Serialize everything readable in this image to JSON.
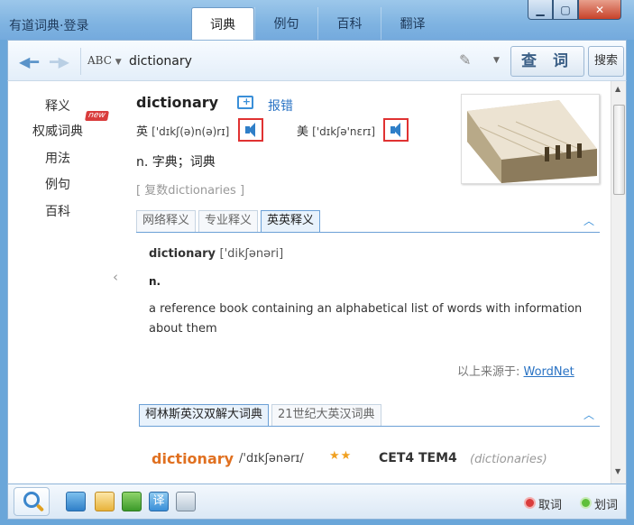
{
  "window": {
    "app_name": "有道词典",
    "login": "·登录",
    "tabs": [
      {
        "label": "词典",
        "active": true
      },
      {
        "label": "例句",
        "active": false
      },
      {
        "label": "百科",
        "active": false
      },
      {
        "label": "翻译",
        "active": false
      }
    ]
  },
  "search": {
    "abc_label": "ABC",
    "value": "dictionary",
    "lookup_button": "查 词",
    "search_button": "搜索"
  },
  "sidebar": {
    "items": [
      "释义",
      "权威词典",
      "用法",
      "例句",
      "百科"
    ],
    "new_badge": "new"
  },
  "entry": {
    "word": "dictionary",
    "report_error": "报错",
    "uk_label": "英",
    "uk_ipa": "['dɪkʃ(ə)n(ə)rɪ]",
    "us_label": "美",
    "us_ipa": "['dɪkʃə'nɛrɪ]",
    "definition": "n. 字典；词典",
    "plural": "[ 复数dictionaries ]"
  },
  "panel1": {
    "tabs": [
      {
        "label": "网络释义",
        "active": false
      },
      {
        "label": "专业释义",
        "active": false
      },
      {
        "label": "英英释义",
        "active": true
      }
    ],
    "word": "dictionary",
    "ipa": "['dikʃənəri]",
    "pos": "n.",
    "definition": "a reference book containing an alphabetical list of words with information about them",
    "source_label": "以上来源于: ",
    "source_link": "WordNet"
  },
  "panel2": {
    "tabs": [
      {
        "label": "柯林斯英汉双解大词典",
        "active": true
      },
      {
        "label": "21世纪大英汉词典",
        "active": false
      }
    ],
    "word": "dictionary",
    "ipa": "/'dɪkʃənərɪ/",
    "stars": "★★",
    "level": "CET4 TEM4",
    "plural": "(dictionaries)"
  },
  "bottom": {
    "cancel_label": "取词",
    "select_label": "划词"
  },
  "colors": {
    "accent": "#2a73c4",
    "word_orange": "#e07020",
    "speaker_highlight": "#e03232"
  }
}
